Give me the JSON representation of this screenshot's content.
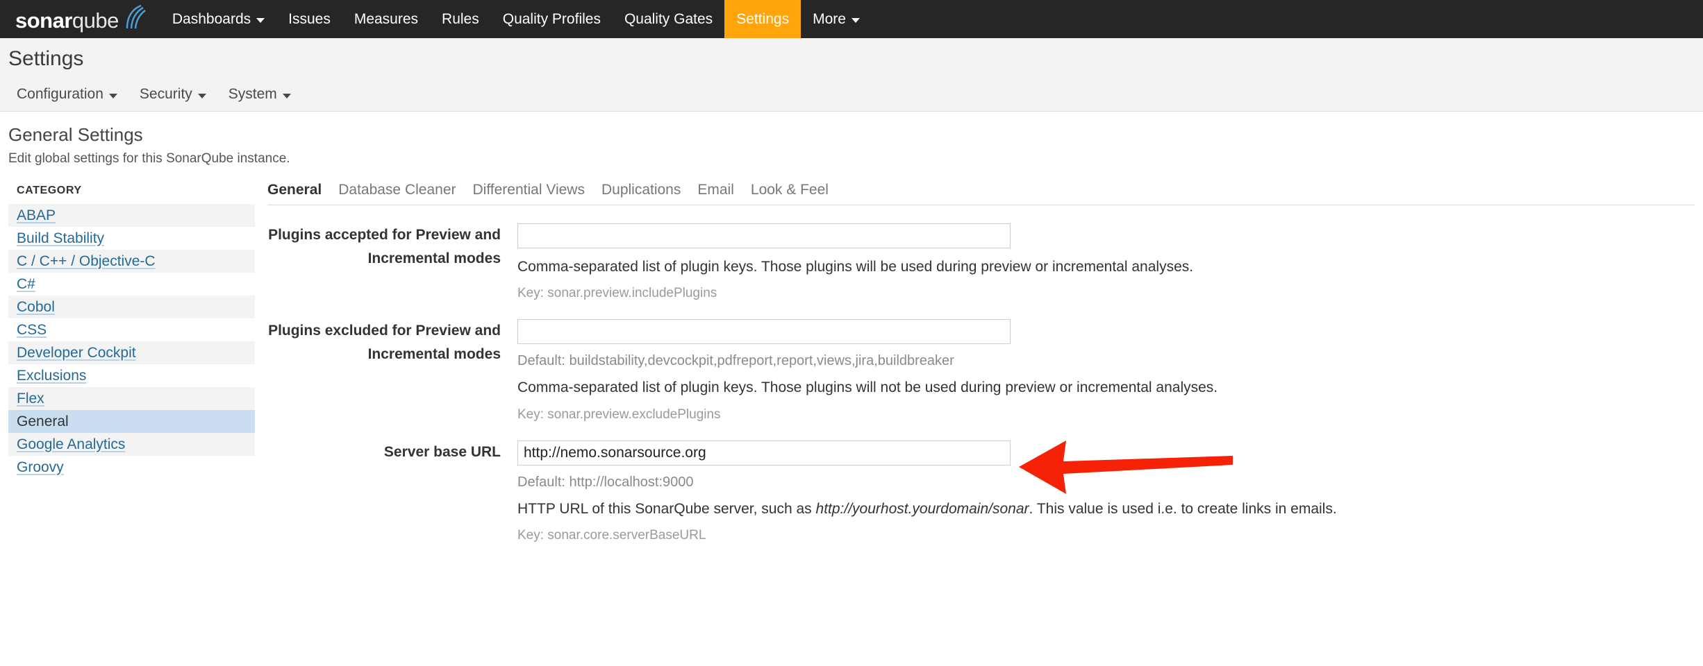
{
  "colors": {
    "nav_background": "#262626",
    "accent_orange": "#FFA40B",
    "link_blue": "#236a97",
    "selected_row": "#C9DEF0",
    "annotation_red": "#F52207"
  },
  "top_nav": {
    "brand": {
      "bold_part": "sonar",
      "light_part": "qube",
      "wave_icon": "signal-wave-icon"
    },
    "items": [
      {
        "label": "Dashboards",
        "has_caret": true,
        "active": false
      },
      {
        "label": "Issues",
        "has_caret": false,
        "active": false
      },
      {
        "label": "Measures",
        "has_caret": false,
        "active": false
      },
      {
        "label": "Rules",
        "has_caret": false,
        "active": false
      },
      {
        "label": "Quality Profiles",
        "has_caret": false,
        "active": false
      },
      {
        "label": "Quality Gates",
        "has_caret": false,
        "active": false
      },
      {
        "label": "Settings",
        "has_caret": false,
        "active": true
      },
      {
        "label": "More",
        "has_caret": true,
        "active": false
      }
    ]
  },
  "page_header": {
    "title": "Settings",
    "sub_nav": [
      {
        "label": "Configuration",
        "has_caret": true
      },
      {
        "label": "Security",
        "has_caret": true
      },
      {
        "label": "System",
        "has_caret": true
      }
    ]
  },
  "main": {
    "heading": "General Settings",
    "description": "Edit global settings for this SonarQube instance.",
    "sidebar": {
      "heading": "CATEGORY",
      "items": [
        {
          "label": "ABAP",
          "selected": false
        },
        {
          "label": "Build Stability",
          "selected": false
        },
        {
          "label": "C / C++ / Objective-C",
          "selected": false
        },
        {
          "label": "C#",
          "selected": false
        },
        {
          "label": "Cobol",
          "selected": false
        },
        {
          "label": "CSS",
          "selected": false
        },
        {
          "label": "Developer Cockpit",
          "selected": false
        },
        {
          "label": "Exclusions",
          "selected": false
        },
        {
          "label": "Flex",
          "selected": false
        },
        {
          "label": "General",
          "selected": true
        },
        {
          "label": "Google Analytics",
          "selected": false
        },
        {
          "label": "Groovy",
          "selected": false
        }
      ]
    },
    "tabs": [
      {
        "label": "General",
        "active": true
      },
      {
        "label": "Database Cleaner",
        "active": false
      },
      {
        "label": "Differential Views",
        "active": false
      },
      {
        "label": "Duplications",
        "active": false
      },
      {
        "label": "Email",
        "active": false
      },
      {
        "label": "Look & Feel",
        "active": false
      }
    ],
    "fields": [
      {
        "label": "Plugins accepted for Preview and Incremental modes",
        "value": "",
        "placeholder": "",
        "default_note": "",
        "description_before": "Comma-separated list of plugin keys. Those plugins will be used during preview or incremental analyses.",
        "description_italic": "",
        "description_after": "",
        "key": "Key: sonar.preview.includePlugins",
        "has_arrow": false
      },
      {
        "label": "Plugins excluded for Preview and Incremental modes",
        "value": "",
        "placeholder": "",
        "default_note": "Default: buildstability,devcockpit,pdfreport,report,views,jira,buildbreaker",
        "description_before": "Comma-separated list of plugin keys. Those plugins will not be used during preview or incremental analyses.",
        "description_italic": "",
        "description_after": "",
        "key": "Key: sonar.preview.excludePlugins",
        "has_arrow": false
      },
      {
        "label": "Server base URL",
        "value": "http://nemo.sonarsource.org",
        "placeholder": "",
        "default_note": "Default: http://localhost:9000",
        "description_before": "HTTP URL of this SonarQube server, such as ",
        "description_italic": "http://yourhost.yourdomain/sonar",
        "description_after": ". This value is used i.e. to create links in emails.",
        "key": "Key: sonar.core.serverBaseURL",
        "has_arrow": true
      }
    ]
  }
}
